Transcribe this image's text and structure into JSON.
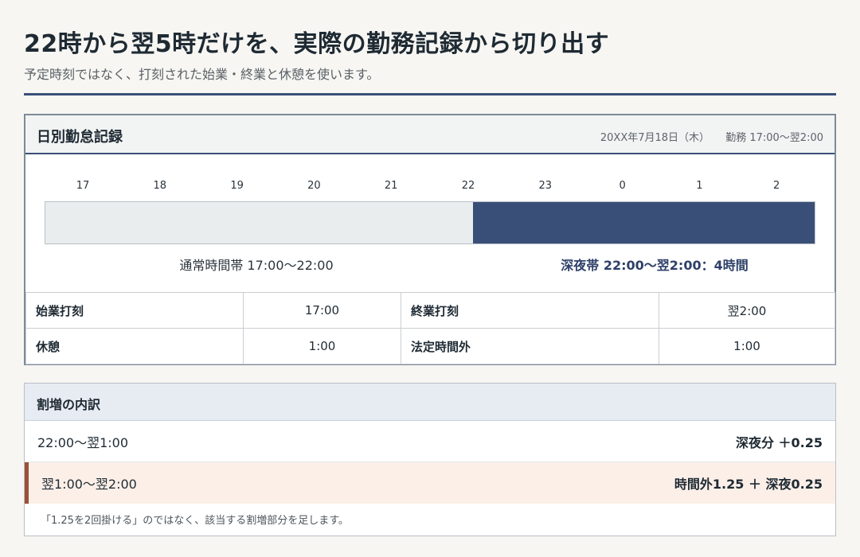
{
  "header": {
    "title": "22時から翌5時だけを、実際の勤務記録から切り出す",
    "subtitle": "予定時刻ではなく、打刻された始業・終業と休憩を使います。"
  },
  "record": {
    "title": "日別勤怠記録",
    "date": "20XX年7月18日（木）",
    "shift": "勤務 17:00〜翌2:00",
    "timeline": {
      "ticks": [
        "17",
        "18",
        "19",
        "20",
        "21",
        "22",
        "23",
        "0",
        "1",
        "2"
      ],
      "normal_label": "通常時間帯 17:00〜22:00",
      "night_label": "深夜帯 22:00〜翌2:00：4時間",
      "normal_fraction": 0.5557,
      "colors": {
        "normal": "#e9edee",
        "night": "#3a4f78"
      }
    },
    "punches": {
      "start_label": "始業打刻",
      "start_value": "17:00",
      "end_label": "終業打刻",
      "end_value": "翌2:00",
      "break_label": "休憩",
      "break_value": "1:00",
      "overtime_label": "法定時間外",
      "overtime_value": "1:00"
    }
  },
  "breakdown": {
    "title": "割増の内訳",
    "rows": [
      {
        "range": "22:00〜翌1:00",
        "rate": "深夜分 ＋0.25"
      },
      {
        "range": "翌1:00〜翌2:00",
        "rate": "時間外1.25 ＋ 深夜0.25"
      }
    ],
    "note": "「1.25を2回掛ける」のではなく、該当する割増部分を足します。",
    "colors": {
      "highlight_bg": "#fbefe8",
      "highlight_accent": "#9a5136"
    }
  }
}
